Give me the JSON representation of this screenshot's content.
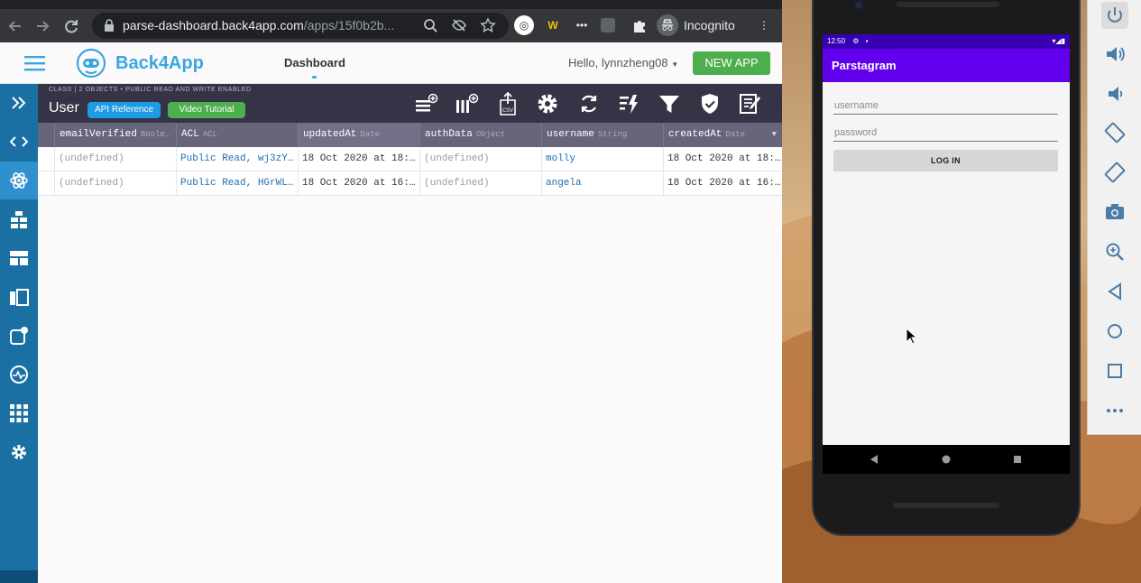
{
  "browser": {
    "url_main": "parse-dashboard.back4app.com",
    "url_rest": "/apps/15f0b2b...",
    "incognito_label": "Incognito"
  },
  "header": {
    "brand": "Back4App",
    "tab_dashboard": "Dashboard",
    "greeting": "Hello, lynnzheng08",
    "new_app_label": "NEW APP"
  },
  "sidebar": {
    "items": [
      {
        "icon": "expand-icon"
      },
      {
        "icon": "code-icon"
      },
      {
        "icon": "atom-icon",
        "active": true
      },
      {
        "icon": "database-icon"
      },
      {
        "icon": "layout-icon"
      },
      {
        "icon": "layers-icon"
      },
      {
        "icon": "push-icon"
      },
      {
        "icon": "activity-icon"
      },
      {
        "icon": "apps-grid-icon"
      },
      {
        "icon": "settings-icon"
      }
    ]
  },
  "toolbar": {
    "subtitle": "CLASS | 2 OBJECTS • PUBLIC READ AND WRITE ENABLED",
    "class_name": "User",
    "api_reference": "API Reference",
    "video_tutorial": "Video Tutorial",
    "api_color": "#1d9be6",
    "video_color": "#4cae4c"
  },
  "table": {
    "columns": [
      {
        "name": "emailVerified",
        "type": "Boole…"
      },
      {
        "name": "ACL",
        "type": "ACL"
      },
      {
        "name": "updatedAt",
        "type": "Date"
      },
      {
        "name": "authData",
        "type": "Object"
      },
      {
        "name": "username",
        "type": "String"
      },
      {
        "name": "createdAt",
        "type": "Date"
      }
    ],
    "rows": [
      [
        "(undefined)",
        "Public Read, wj3zY…",
        "18 Oct 2020 at 18:…",
        "(undefined)",
        "molly",
        "18 Oct 2020 at 18:…"
      ],
      [
        "(undefined)",
        "Public Read, HGrWL…",
        "18 Oct 2020 at 16:…",
        "(undefined)",
        "angela",
        "18 Oct 2020 at 16:…"
      ]
    ]
  },
  "phone": {
    "time": "12:50",
    "app_title": "Parstagram",
    "username_placeholder": "username",
    "password_placeholder": "password",
    "login_label": "LOG IN"
  }
}
